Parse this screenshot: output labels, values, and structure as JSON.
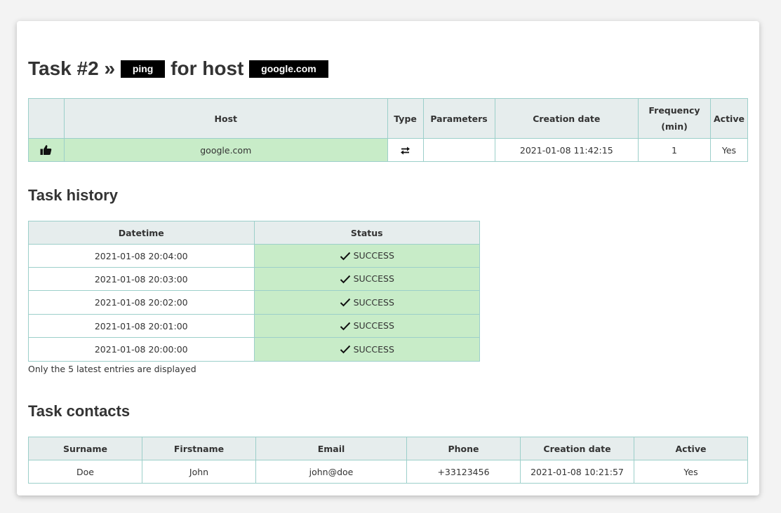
{
  "title": {
    "prefix": "Task #2 »",
    "type_badge": "ping",
    "middle": "for host",
    "host_badge": "google.com"
  },
  "task_table": {
    "headers": [
      "",
      "Host",
      "Type",
      "Parameters",
      "Creation date",
      "Frequency (min)",
      "Active"
    ],
    "row": {
      "status_icon": "thumbs-up-icon",
      "host": "google.com",
      "type_icon": "exchange-arrows-icon",
      "parameters": "",
      "creation_date": "2021-01-08 11:42:15",
      "frequency": "1",
      "active": "Yes"
    }
  },
  "history": {
    "heading": "Task history",
    "headers": [
      "Datetime",
      "Status"
    ],
    "rows": [
      {
        "datetime": "2021-01-08 20:04:00",
        "status": "SUCCESS",
        "icon": "check-icon"
      },
      {
        "datetime": "2021-01-08 20:03:00",
        "status": "SUCCESS",
        "icon": "check-icon"
      },
      {
        "datetime": "2021-01-08 20:02:00",
        "status": "SUCCESS",
        "icon": "check-icon"
      },
      {
        "datetime": "2021-01-08 20:01:00",
        "status": "SUCCESS",
        "icon": "check-icon"
      },
      {
        "datetime": "2021-01-08 20:00:00",
        "status": "SUCCESS",
        "icon": "check-icon"
      }
    ],
    "note": "Only the 5 latest entries are displayed"
  },
  "contacts": {
    "heading": "Task contacts",
    "headers": [
      "Surname",
      "Firstname",
      "Email",
      "Phone",
      "Creation date",
      "Active"
    ],
    "rows": [
      {
        "surname": "Doe",
        "firstname": "John",
        "email": "john@doe",
        "phone": "+33123456",
        "creation_date": "2021-01-08 10:21:57",
        "active": "Yes"
      }
    ]
  },
  "colors": {
    "success_bg": "#c8ecc8",
    "header_bg": "#e6eded",
    "border": "#9ccfca",
    "badge_bg": "#000000"
  }
}
